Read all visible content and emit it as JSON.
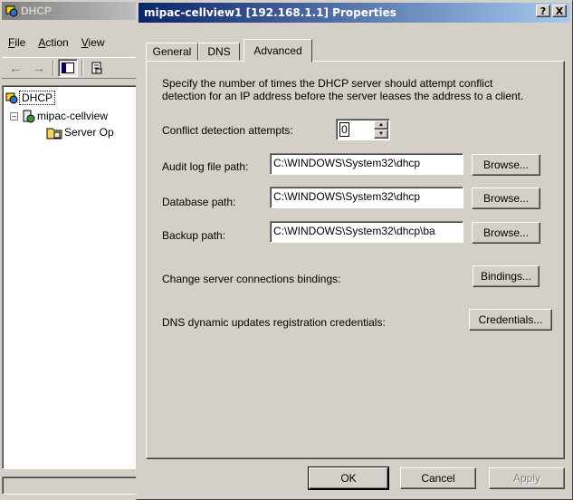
{
  "mmc": {
    "title": "DHCP",
    "menu": [
      "File",
      "Action",
      "View"
    ],
    "tree": [
      "DHCP",
      "mipac-cellview",
      "Server Op"
    ]
  },
  "dialog": {
    "title": "mipac-cellview1 [192.168.1.1] Properties",
    "help_btn": "?",
    "close_btn": "X",
    "tabs": [
      "General",
      "DNS",
      "Advanced"
    ],
    "active_tab": "Advanced",
    "description_line1": "Specify the number of times the DHCP server should attempt conflict",
    "description_line2": "detection for an IP address before the server leases the address to a client.",
    "conflict_label": "Conflict detection attempts:",
    "conflict_value": "0",
    "audit_label": "Audit log file path:",
    "audit_value": "C:\\WINDOWS\\System32\\dhcp",
    "database_label": "Database path:",
    "database_value": "C:\\WINDOWS\\System32\\dhcp",
    "backup_label": "Backup path:",
    "backup_value": "C:\\WINDOWS\\System32\\dhcp\\ba",
    "browse_label": "Browse...",
    "bindings_label": "Change server connections bindings:",
    "bindings_button": "Bindings...",
    "credentials_label": "DNS dynamic updates registration credentials:",
    "credentials_button": "Credentials...",
    "ok": "OK",
    "cancel": "Cancel",
    "apply": "Apply"
  }
}
